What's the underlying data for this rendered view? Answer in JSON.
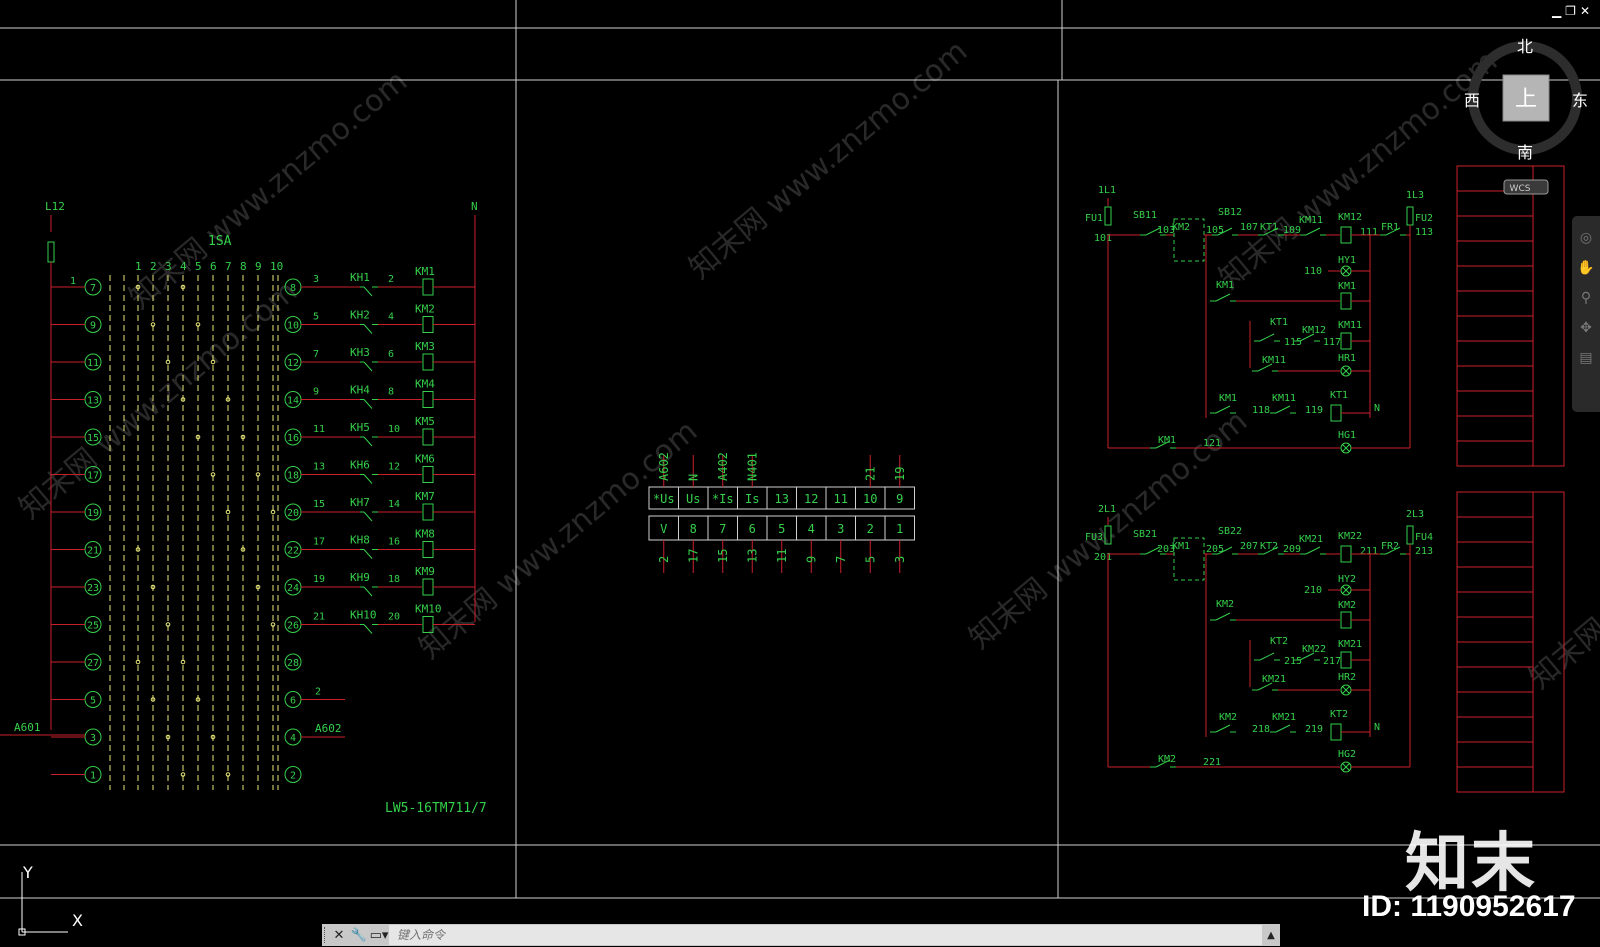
{
  "window": {
    "minimize": "▁",
    "restore": "❐",
    "close": "✕"
  },
  "viewcube": {
    "north": "北",
    "south": "南",
    "east": "东",
    "west": "西",
    "top": "上",
    "wcs": "WCS"
  },
  "ucs": {
    "x": "X",
    "y": "Y"
  },
  "command": {
    "placeholder": "键入命令",
    "close_icon": "close-icon",
    "wrench_icon": "wrench-icon",
    "prompt_icon": "prompt-icon",
    "up_icon": "chevron-up-icon"
  },
  "watermark": {
    "logo": "知末",
    "id": "ID: 1190952617",
    "text": "知末网 www.znzmo.com"
  },
  "navbar": [
    "orbit-icon",
    "pan-icon",
    "zoom-icon",
    "walk-icon",
    "showmotion-icon"
  ],
  "colors": {
    "wire": "#c8202a",
    "text": "#35d04b",
    "frame": "#cfcfcf",
    "dashed": "#e8e878"
  },
  "panel1": {
    "phase": "L12",
    "neutral": "N",
    "switch": "1SA",
    "model": "LW5-16TM711/7",
    "wire1": "1",
    "left_label": "A601",
    "right_label": "A602",
    "right_wire": "2",
    "columns": [
      "1",
      "2",
      "3",
      "4",
      "5",
      "6",
      "7",
      "8",
      "9",
      "10"
    ],
    "left_terms": [
      "7",
      "9",
      "11",
      "13",
      "15",
      "17",
      "19",
      "21",
      "23",
      "25",
      "27",
      "5",
      "3",
      "1"
    ],
    "right_terms": [
      "8",
      "10",
      "12",
      "14",
      "16",
      "18",
      "20",
      "22",
      "24",
      "26",
      "28",
      "6",
      "4",
      "2"
    ],
    "rows": [
      {
        "in": "3",
        "kh": "KH1",
        "out": "2",
        "km": "KM1"
      },
      {
        "in": "5",
        "kh": "KH2",
        "out": "4",
        "km": "KM2"
      },
      {
        "in": "7",
        "kh": "KH3",
        "out": "6",
        "km": "KM3"
      },
      {
        "in": "9",
        "kh": "KH4",
        "out": "8",
        "km": "KM4"
      },
      {
        "in": "11",
        "kh": "KH5",
        "out": "10",
        "km": "KM5"
      },
      {
        "in": "13",
        "kh": "KH6",
        "out": "12",
        "km": "KM6"
      },
      {
        "in": "15",
        "kh": "KH7",
        "out": "14",
        "km": "KM7"
      },
      {
        "in": "17",
        "kh": "KH8",
        "out": "16",
        "km": "KM8"
      },
      {
        "in": "19",
        "kh": "KH9",
        "out": "18",
        "km": "KM9"
      },
      {
        "in": "21",
        "kh": "KH10",
        "out": "20",
        "km": "KM10"
      }
    ]
  },
  "panel2": {
    "top_row": [
      "*Us",
      "Us",
      "*Is",
      "Is",
      "13",
      "12",
      "11",
      "10",
      "9"
    ],
    "bottom_row": [
      "V",
      "8",
      "7",
      "6",
      "5",
      "4",
      "3",
      "2",
      "1"
    ],
    "top_labels": [
      "A602",
      "N",
      "A402",
      "N401",
      "",
      "",
      "",
      "21",
      "19"
    ],
    "bottom_labels": [
      "2",
      "17",
      "15",
      "13",
      "11",
      "9",
      "7",
      "5",
      "3"
    ]
  },
  "panel3": {
    "circuits": [
      {
        "phase": "1L1",
        "fu_l": "FU1",
        "w0": "101",
        "sb1": "SB11",
        "w1": "103",
        "km_other": "KM2",
        "w2": "105",
        "sb2": "SB12",
        "w3": "107",
        "kt": "KT1",
        "w4": "109",
        "km_b": "KM11",
        "w5": "111",
        "km_c": "KM12",
        "fr": "FR1",
        "fu_r": "FU2",
        "w6": "113",
        "phase_r": "1L3",
        "hy": "HY1",
        "w7": "110",
        "km": "KM1",
        "km_main": "KM1",
        "kt_c": "KT1",
        "km_x": "KM12",
        "km_y": "KM11",
        "w8": "115",
        "w9": "117",
        "km_z": "KM11",
        "hr": "HR1",
        "km_d": "KM1",
        "km_e": "KM11",
        "w10": "118",
        "w11": "119",
        "kt_coil": "KT1",
        "n": "N",
        "km_f": "KM1",
        "w12": "121",
        "hg": "HG1"
      },
      {
        "phase": "2L1",
        "fu_l": "FU3",
        "w0": "201",
        "sb1": "SB21",
        "w1": "203",
        "km_other": "KM1",
        "w2": "205",
        "sb2": "SB22",
        "w3": "207",
        "kt": "KT2",
        "w4": "209",
        "km_b": "KM21",
        "w5": "211",
        "km_c": "KM22",
        "fr": "FR2",
        "fu_r": "FU4",
        "w6": "213",
        "phase_r": "2L3",
        "hy": "HY2",
        "w7": "210",
        "km": "KM2",
        "km_main": "KM2",
        "kt_c": "KT2",
        "km_x": "KM22",
        "km_y": "KM21",
        "w8": "215",
        "w9": "217",
        "km_z": "KM21",
        "hr": "HR2",
        "km_d": "KM2",
        "km_e": "KM21",
        "w10": "218",
        "w11": "219",
        "kt_coil": "KT2",
        "n": "N",
        "km_f": "KM2",
        "w12": "221",
        "hg": "HG2"
      }
    ]
  }
}
